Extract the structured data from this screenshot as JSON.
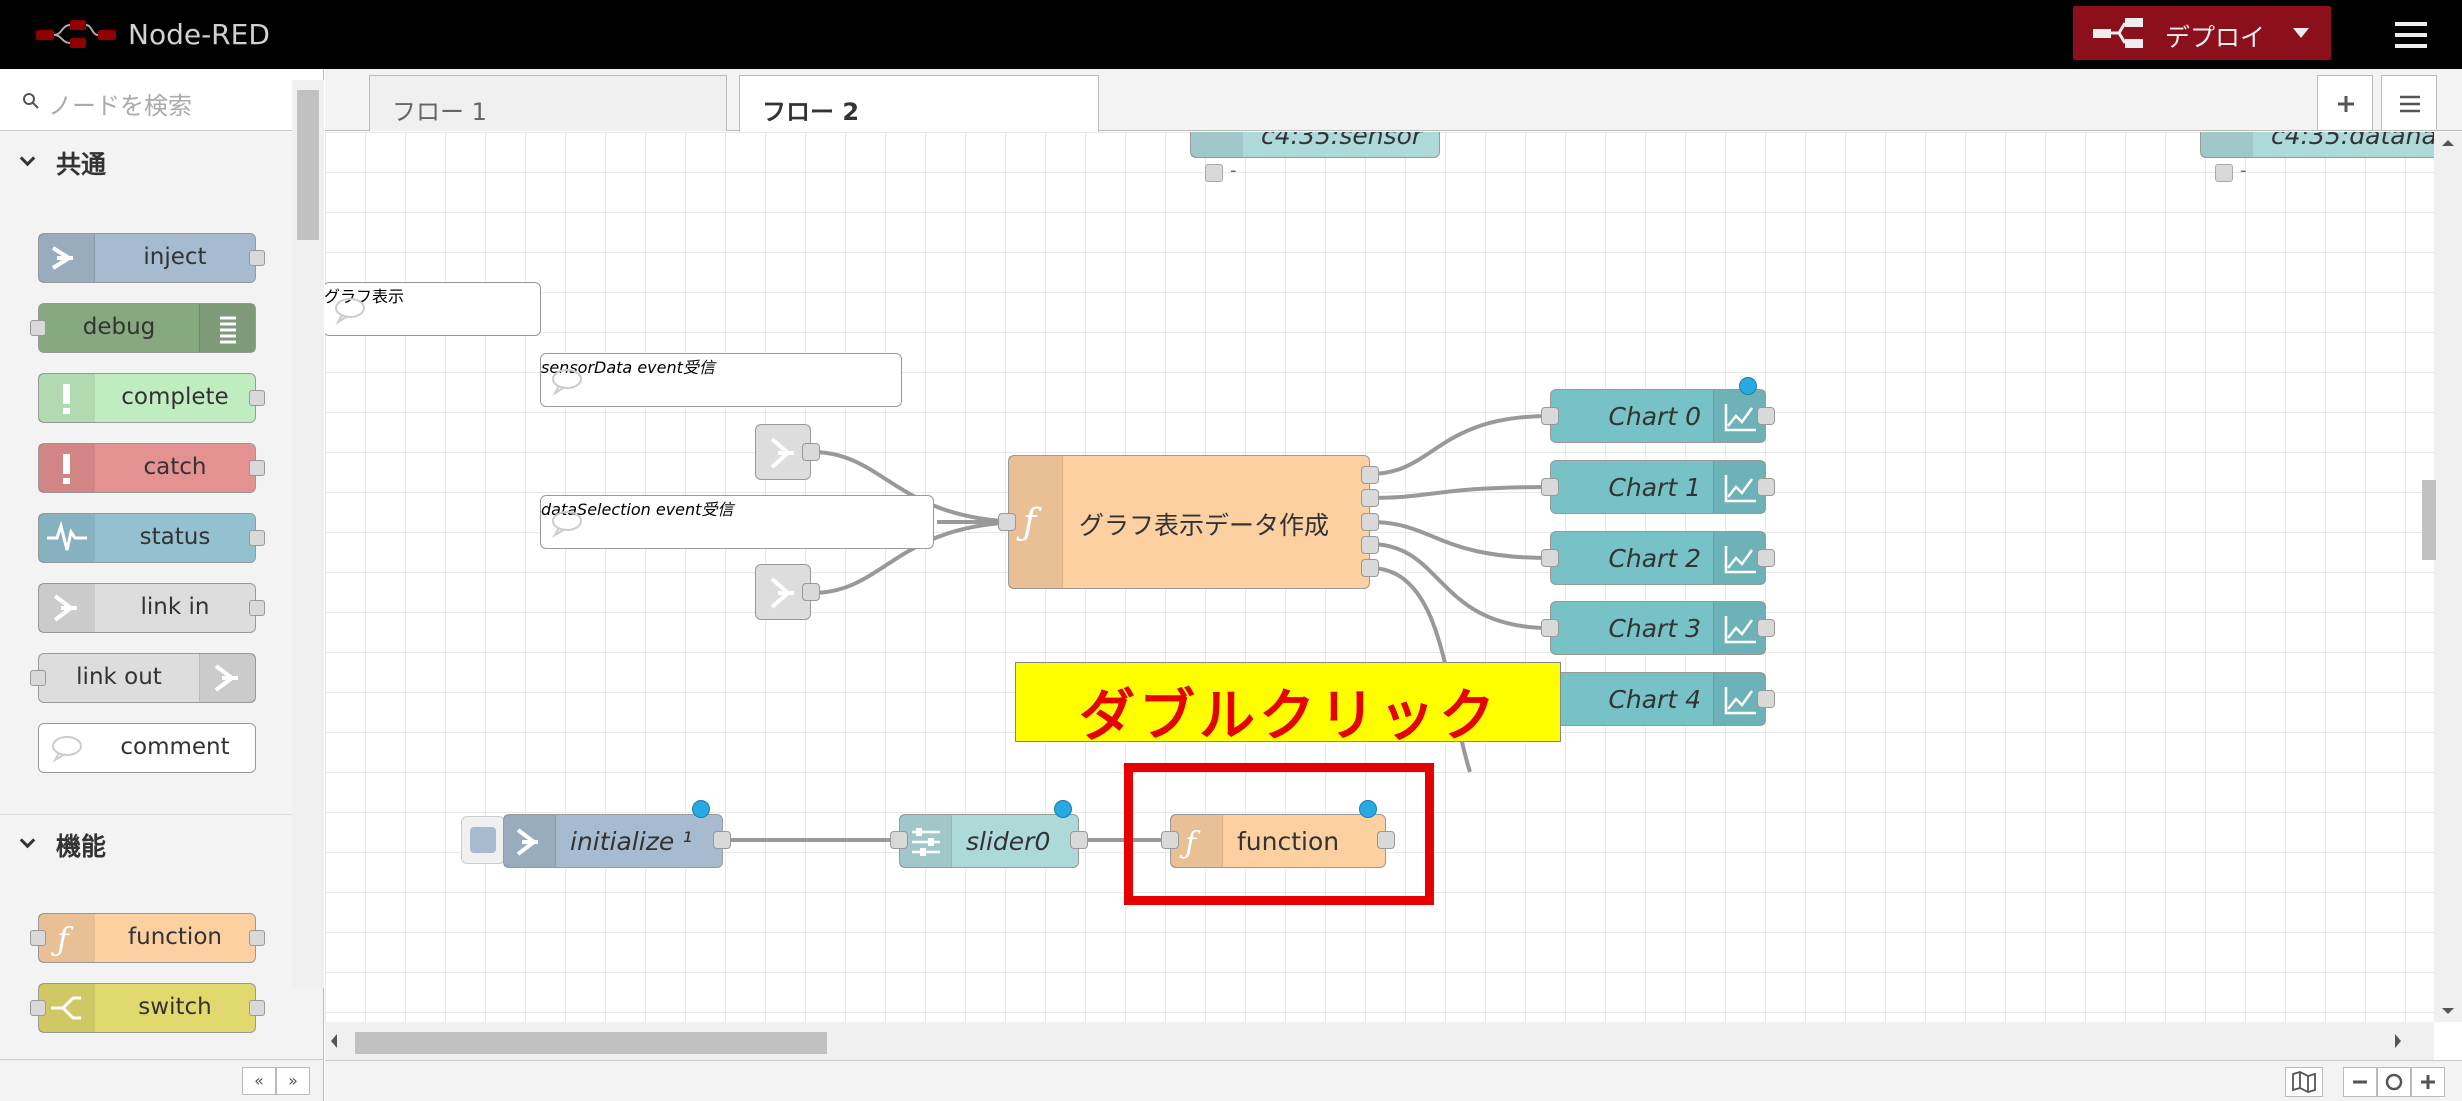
{
  "header": {
    "title": "Node-RED",
    "deploy_label": "デプロイ"
  },
  "palette": {
    "search_placeholder": "ノードを検索",
    "categories": [
      {
        "label": "共通",
        "nodes": [
          "inject",
          "debug",
          "complete",
          "catch",
          "status",
          "link in",
          "link out",
          "comment"
        ]
      },
      {
        "label": "機能",
        "nodes": [
          "function",
          "switch"
        ]
      }
    ]
  },
  "tabs": [
    {
      "label": "フロー 1",
      "active": false
    },
    {
      "label": "フロー 2",
      "active": true
    }
  ],
  "flow": {
    "top_nodes": [
      "c4:35:sensor",
      "c4:35:datana"
    ],
    "status_dash": "-",
    "comments": [
      "グラフ表示",
      "sensorData event受信",
      "dataSelection event受信"
    ],
    "function_node": "グラフ表示データ作成",
    "charts": [
      "Chart 0",
      "Chart 1",
      "Chart 2",
      "Chart 3",
      "Chart 4"
    ],
    "inject_node": "initialize ¹",
    "slider_node": "slider0",
    "new_function_node": "function"
  },
  "annotation": {
    "text": "ダブルクリック"
  },
  "colors": {
    "header_bg": "#000000",
    "deploy_bg": "#8c101c",
    "inject": "#a6bbcf",
    "debug": "#87a980",
    "complete": "#c0edc0",
    "catch": "#e49191",
    "status": "#94c1d0",
    "link": "#dddddd",
    "function": "#fdd0a2",
    "switch": "#e2d96e",
    "chart": "#77c2c6",
    "slider": "#aed9d9",
    "annotation_bg": "#ffff00",
    "annotation_text": "#e60000"
  }
}
